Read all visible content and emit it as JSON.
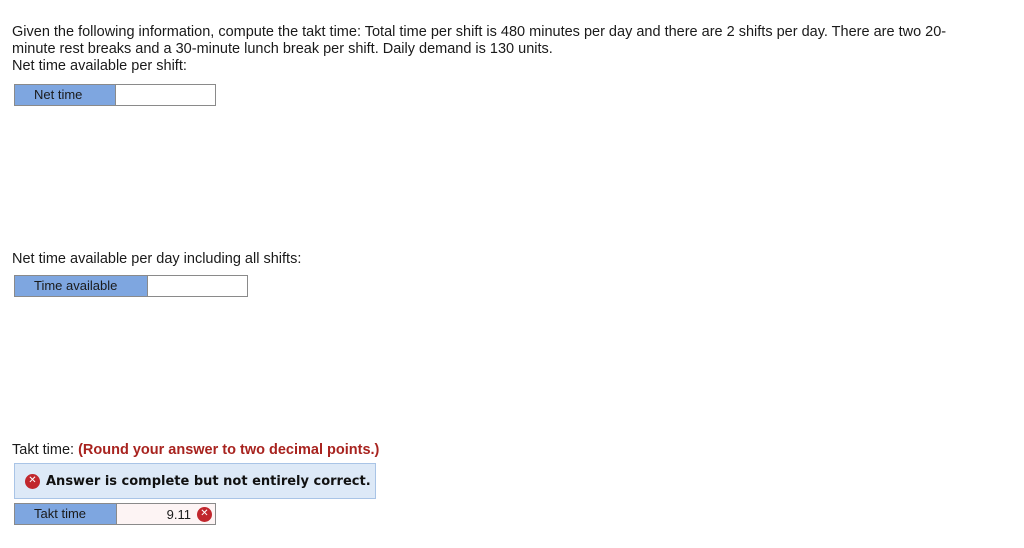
{
  "question": {
    "text": "Given the following information, compute the takt time: Total time per shift is 480 minutes per day and there are 2 shifts per day. There are two 20-minute rest breaks and a 30-minute lunch break per shift. Daily demand is 130 units.",
    "net_time_prompt": "Net time available per shift:"
  },
  "net_time": {
    "label": "Net time",
    "value": ""
  },
  "time_available": {
    "prompt": "Net time available per day including all shifts:",
    "label": "Time available",
    "value": ""
  },
  "takt": {
    "prompt": "Takt time:",
    "hint": "(Round your answer to two decimal points.)",
    "feedback": "Answer is complete but not entirely correct.",
    "label": "Takt time",
    "value": "9.11",
    "status_icon": "incorrect-x-icon",
    "error_color": "#c1272d"
  }
}
